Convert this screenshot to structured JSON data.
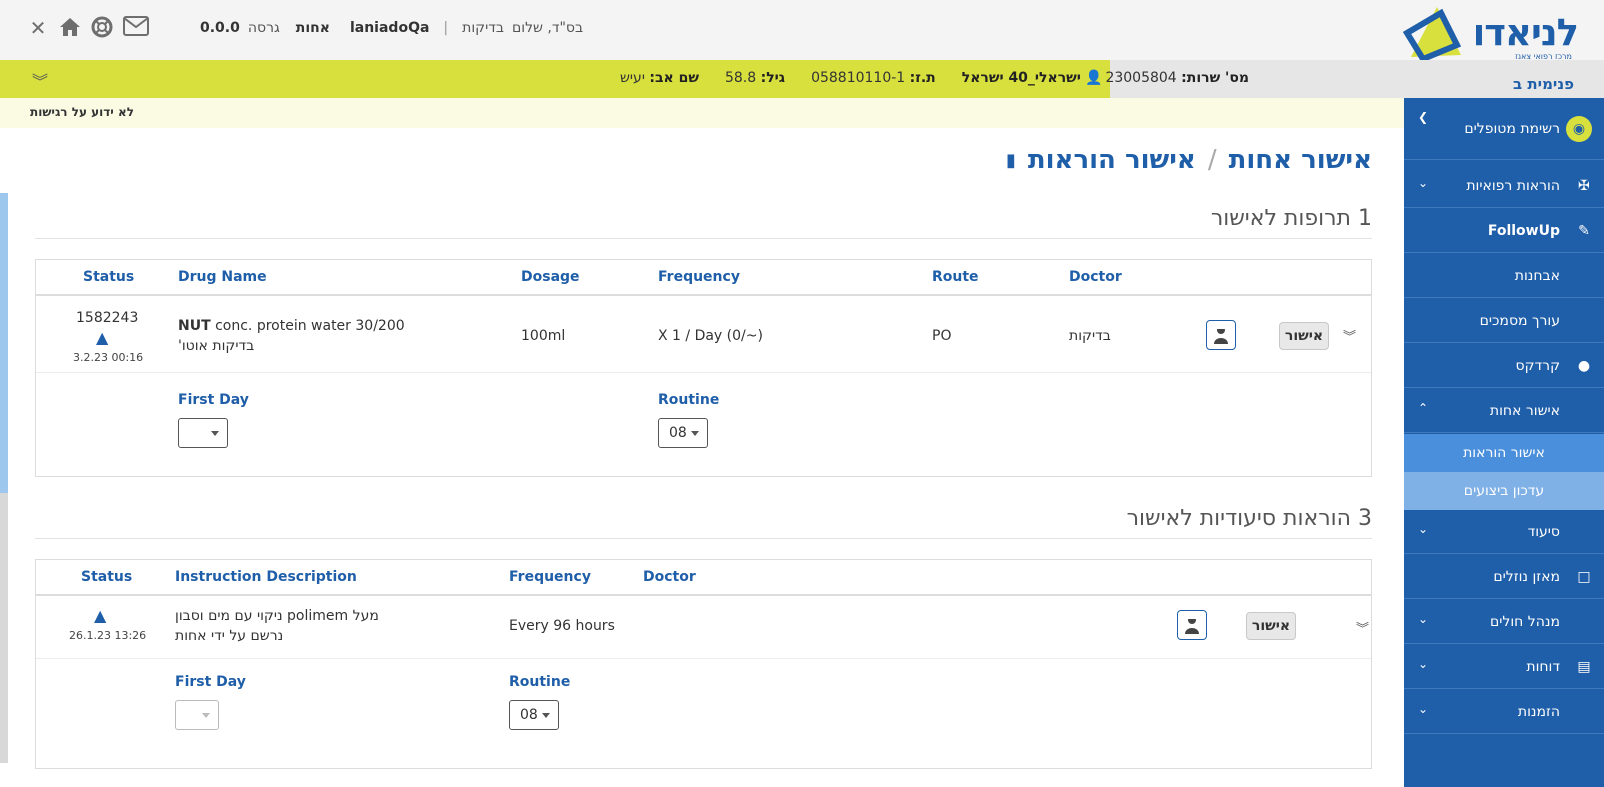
{
  "header": {
    "logo_text": "לניאדו",
    "logo_subtext": "מרכז רפואי צאנז",
    "greeting": "בס\"ד, שלום",
    "user_name": "בדיקות",
    "username": "laniadoQa",
    "role": "אחות",
    "version_label": "גרסה",
    "version": "0.0.0",
    "icons": [
      "close-icon",
      "home-icon",
      "help-icon",
      "mail-icon"
    ]
  },
  "patient": {
    "serial_label": "מס' שרות:",
    "serial": "23005804",
    "name": "ישראלי_40 ישראל",
    "id_label": "ת.ז:",
    "id": "058810110-1",
    "age_label": "גיל:",
    "age": "58.8",
    "father_label": "שם אב:",
    "father": "יעיש",
    "allergy": "לא ידוע על רגישות"
  },
  "sidebar": {
    "ward": "פנימית ב",
    "items": [
      {
        "label": "רשימת מטופלים",
        "icon": "people-icon",
        "chevron": "‹"
      },
      {
        "label": "הוראות רפואיות",
        "icon": "stethoscope-icon",
        "chevron": "⌄"
      },
      {
        "label": "FollowUp",
        "icon": "pencil-icon",
        "chevron": ""
      },
      {
        "label": "אבחנות",
        "icon": "",
        "chevron": ""
      },
      {
        "label": "עורך מסמכים",
        "icon": "",
        "chevron": ""
      },
      {
        "label": "קרדקס",
        "icon": "pill-icon",
        "chevron": ""
      },
      {
        "label": "אישור אחות",
        "icon": "",
        "chevron": "^"
      },
      {
        "label": "סיעוד",
        "icon": "",
        "chevron": "⌄"
      },
      {
        "label": "מאזן נוזלים",
        "icon": "chat-icon",
        "chevron": ""
      },
      {
        "label": "מנהל חולים",
        "icon": "",
        "chevron": "⌄"
      },
      {
        "label": "דוחות",
        "icon": "clipboard-icon",
        "chevron": "⌄"
      },
      {
        "label": "הזמנות",
        "icon": "",
        "chevron": "⌄"
      }
    ],
    "subitems": [
      {
        "label": "אישור הוראות"
      },
      {
        "label": "עדכון ביצועים"
      }
    ]
  },
  "page": {
    "breadcrumb_root": "אישור אחות",
    "breadcrumb_current": "אישור הוראות"
  },
  "drugs_section": {
    "title": "1 תרופות לאישור",
    "columns": [
      "Status",
      "Drug Name",
      "Dosage",
      "Frequency",
      "Route",
      "Doctor"
    ],
    "row": {
      "status_id": "1582243",
      "status_time": "3.2.23 00:16",
      "drug_bold": "NUT",
      "drug_name": "conc. protein water 30/200",
      "drug_note": "בדיקות אוטו'",
      "dosage": "100ml",
      "frequency": "X 1 / Day (0/~)",
      "route": "PO",
      "doctor": "בדיקות",
      "approve": "אישור"
    },
    "first_day_label": "First Day",
    "first_day_value": "",
    "routine_label": "Routine",
    "routine_value": "08"
  },
  "nursing_section": {
    "title": "3 הוראות סיעודיות לאישור",
    "columns": [
      "Status",
      "Instruction Description",
      "Frequency",
      "Doctor"
    ],
    "row": {
      "status_time": "26.1.23 13:26",
      "desc_line1": "מעל polimem ניקוי עם מים וסבון",
      "desc_line2": "נרשם על ידי אחות",
      "frequency": "Every 96 hours",
      "doctor": "",
      "approve": "אישור"
    },
    "first_day_label": "First Day",
    "first_day_value": "",
    "routine_label": "Routine",
    "routine_value": "08"
  }
}
